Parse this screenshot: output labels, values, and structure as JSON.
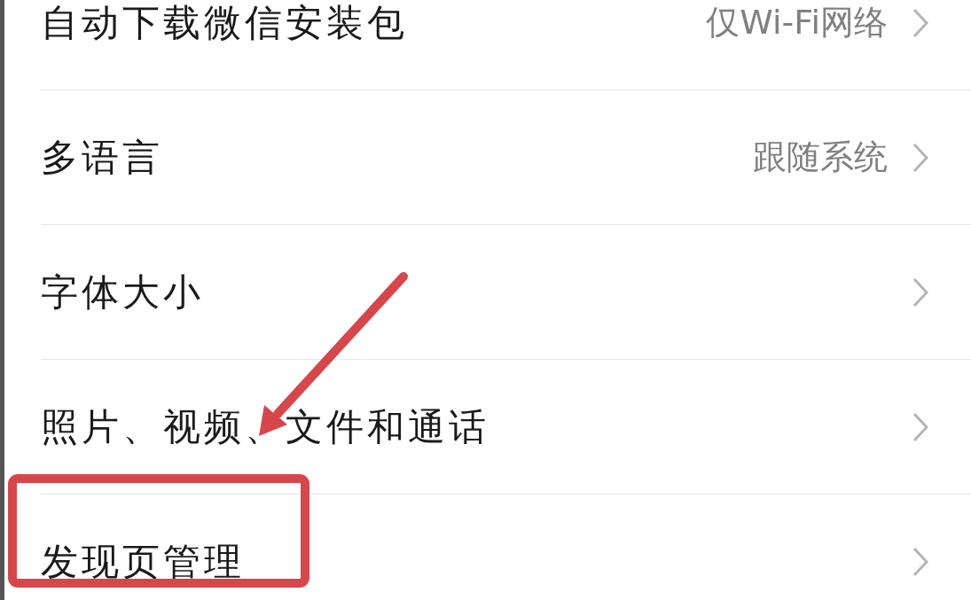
{
  "settings_rows": [
    {
      "label": "自动下载微信安装包",
      "value": "仅Wi-Fi网络"
    },
    {
      "label": "多语言",
      "value": "跟随系统"
    },
    {
      "label": "字体大小"
    },
    {
      "label": "照片、视频、文件和通话"
    },
    {
      "label": "发现页管理"
    }
  ]
}
